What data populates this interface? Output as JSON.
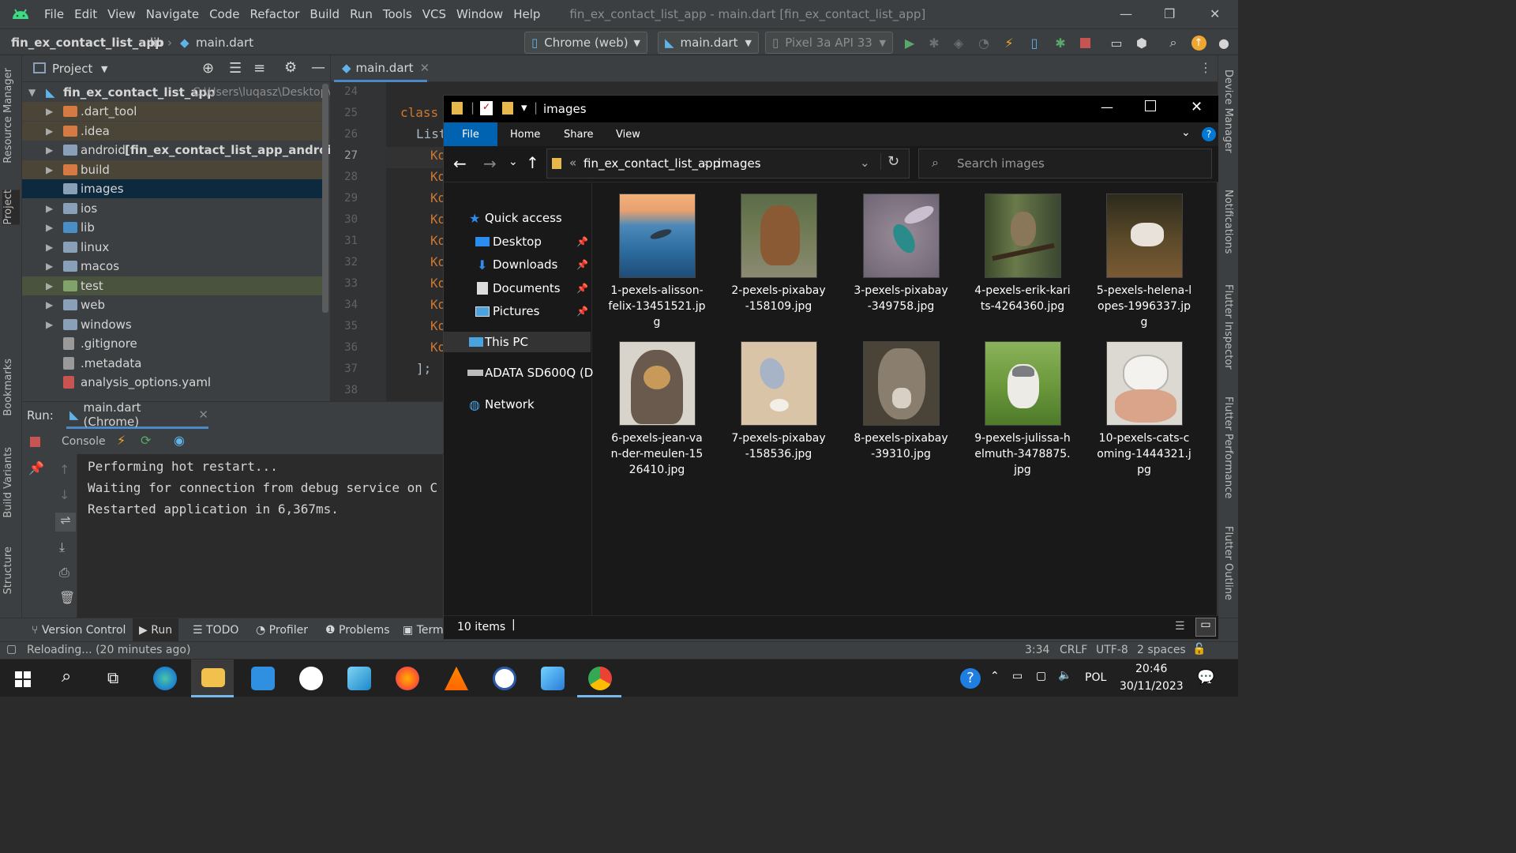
{
  "ide": {
    "menu": [
      "File",
      "Edit",
      "View",
      "Navigate",
      "Code",
      "Refactor",
      "Build",
      "Run",
      "Tools",
      "VCS",
      "Window",
      "Help"
    ],
    "window_title": "fin_ex_contact_list_app - main.dart [fin_ex_contact_list_app]",
    "breadcrumb": {
      "project": "fin_ex_contact_list_app",
      "folder": "lib",
      "file": "main.dart"
    },
    "device_selector": "Chrome (web)",
    "run_config": "main.dart",
    "emulator": "Pixel 3a API 33",
    "project_panel": {
      "title": "Project",
      "root": "fin_ex_contact_list_app",
      "root_path": "C:\\Users\\luqasz\\Desktop\\fi",
      "items": [
        {
          "label": ".dart_tool",
          "note": ""
        },
        {
          "label": ".idea",
          "note": ""
        },
        {
          "label": "android",
          "note": "[fin_ex_contact_list_app_android]"
        },
        {
          "label": "build",
          "note": ""
        },
        {
          "label": "images",
          "note": ""
        },
        {
          "label": "ios",
          "note": ""
        },
        {
          "label": "lib",
          "note": ""
        },
        {
          "label": "linux",
          "note": ""
        },
        {
          "label": "macos",
          "note": ""
        },
        {
          "label": "test",
          "note": ""
        },
        {
          "label": "web",
          "note": ""
        },
        {
          "label": "windows",
          "note": ""
        },
        {
          "label": ".gitignore",
          "note": ""
        },
        {
          "label": ".metadata",
          "note": ""
        },
        {
          "label": "analysis_options.yaml",
          "note": ""
        }
      ]
    },
    "editor": {
      "tab": "main.dart",
      "line_numbers": [
        "24",
        "25",
        "26",
        "27",
        "28",
        "29",
        "30",
        "31",
        "32",
        "33",
        "34",
        "35",
        "36",
        "37",
        "38"
      ],
      "line25": "class",
      "line26": "List",
      "k_prefix": "Ko",
      "line37": "];"
    },
    "run_panel": {
      "label": "Run:",
      "tab": "main.dart (Chrome)",
      "console_label": "Console",
      "lines": [
        "Performing hot restart...",
        "Waiting for connection from debug service on C",
        "Restarted application in 6,367ms."
      ]
    },
    "bottom_tools": [
      "Version Control",
      "Run",
      "TODO",
      "Profiler",
      "Problems",
      "Term"
    ],
    "status": {
      "message": "Reloading... (20 minutes ago)",
      "position": "3:34",
      "line_ending": "CRLF",
      "encoding": "UTF-8",
      "indent": "2 spaces"
    },
    "side_labels": {
      "left": [
        "Resource Manager",
        "Project",
        "Bookmarks",
        "Build Variants",
        "Structure"
      ],
      "right": [
        "Device Manager",
        "Notifications",
        "Flutter Inspector",
        "Flutter Performance",
        "Flutter Outline"
      ]
    }
  },
  "explorer": {
    "title": "images",
    "ribbon_tabs": [
      "File",
      "Home",
      "Share",
      "View"
    ],
    "address": {
      "parent": "fin_ex_contact_list_app",
      "current": "images"
    },
    "search_placeholder": "Search images",
    "nav": {
      "quick_access": "Quick access",
      "pinned": [
        "Desktop",
        "Downloads",
        "Documents",
        "Pictures"
      ],
      "this_pc": "This PC",
      "drive": "ADATA SD600Q (D:)",
      "network": "Network"
    },
    "files": [
      {
        "name": "1-pexels-alisson-felix-13451521.jpg",
        "lines": [
          "1-pexels-alisson-",
          "felix-13451521.jp",
          "g"
        ],
        "subject": "dolphin"
      },
      {
        "name": "2-pexels-pixabay-158109.jpg",
        "lines": [
          "2-pexels-pixabay",
          "-158109.jpg"
        ],
        "subject": "bear"
      },
      {
        "name": "3-pexels-pixabay-349758.jpg",
        "lines": [
          "3-pexels-pixabay",
          "-349758.jpg"
        ],
        "subject": "hummingbird"
      },
      {
        "name": "4-pexels-erik-karits-4264360.jpg",
        "lines": [
          "4-pexels-erik-kari",
          "ts-4264360.jpg"
        ],
        "subject": "owl"
      },
      {
        "name": "5-pexels-helena-lopes-1996337.jpg",
        "lines": [
          "5-pexels-helena-l",
          "opes-1996337.jp",
          "g"
        ],
        "subject": "horse"
      },
      {
        "name": "6-pexels-jean-van-der-meulen-1526410.jpg",
        "lines": [
          "6-pexels-jean-va",
          "n-der-meulen-15",
          "26410.jpg"
        ],
        "subject": "kestrel"
      },
      {
        "name": "7-pexels-pixabay-158536.jpg",
        "lines": [
          "7-pexels-pixabay",
          "-158536.jpg"
        ],
        "subject": "butterfly"
      },
      {
        "name": "8-pexels-pixabay-39310.jpg",
        "lines": [
          "8-pexels-pixabay",
          "-39310.jpg"
        ],
        "subject": "wolf"
      },
      {
        "name": "9-pexels-julissa-helmuth-3478875.jpg",
        "lines": [
          "9-pexels-julissa-h",
          "elmuth-3478875.",
          "jpg"
        ],
        "subject": "husky puppy"
      },
      {
        "name": "10-pexels-cats-coming-1444321.jpg",
        "lines": [
          "10-pexels-cats-c",
          "oming-1444321.j",
          "pg"
        ],
        "subject": "kitten"
      }
    ],
    "status_count": "10 items"
  },
  "taskbar": {
    "lang": "POL",
    "time": "20:46",
    "date": "30/11/2023",
    "notification_count": "1"
  },
  "colors": {
    "ide_bg": "#2b2b2b",
    "ide_panel": "#3c3f41",
    "selection": "#0d293e",
    "explorer_bg": "#191919",
    "accent_blue": "#0078d4",
    "folder_yellow": "#e8b84a"
  }
}
